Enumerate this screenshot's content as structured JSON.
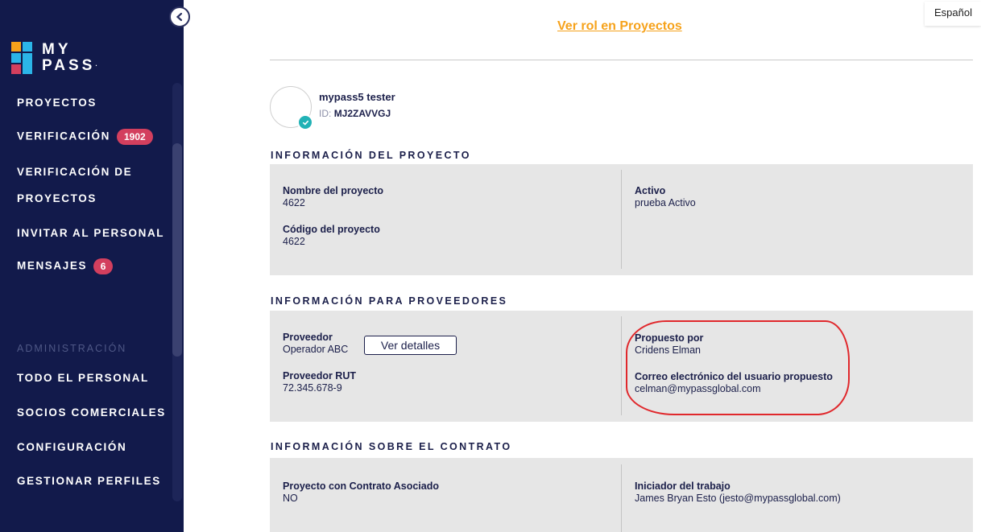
{
  "brand": {
    "line1": "MY",
    "line2": "PASS",
    "mark": "·"
  },
  "sidebar": {
    "items": [
      {
        "label": "PROYECTOS"
      },
      {
        "label": "VERIFICACIÓN",
        "badge": "1902"
      },
      {
        "label": "VERIFICACIÓN DE"
      },
      {
        "label": "PROYECTOS"
      },
      {
        "label": "INVITAR AL PERSONAL"
      },
      {
        "label": "MENSAJES",
        "badge": "6"
      }
    ],
    "admin_header": "ADMINISTRACIÓN",
    "admin_items": [
      {
        "label": "TODO EL PERSONAL"
      },
      {
        "label": "SOCIOS COMERCIALES"
      },
      {
        "label": "CONFIGURACIÓN"
      },
      {
        "label": "GESTIONAR PERFILES"
      }
    ]
  },
  "header": {
    "language": "Español",
    "link": "Ver rol en Proyectos"
  },
  "profile": {
    "name": "mypass5 tester",
    "id_label": "ID:",
    "id_value": "MJ2ZAVVGJ"
  },
  "project_info": {
    "title": "INFORMACIÓN DEL PROYECTO",
    "name_label": "Nombre del proyecto",
    "name_value": "4622",
    "code_label": "Código del proyecto",
    "code_value": "4622",
    "status_label": "Activo",
    "status_value": "prueba Activo"
  },
  "supplier_info": {
    "title": "INFORMACIÓN PARA PROVEEDORES",
    "supplier_label": "Proveedor",
    "supplier_value": "Operador ABC",
    "details_button": "Ver detalles",
    "rut_label": "Proveedor RUT",
    "rut_value": "72.345.678-9",
    "proposed_label": "Propuesto por",
    "proposed_value": "Cridens Elman",
    "email_label": "Correo electrónico del usuario propuesto",
    "email_value": "celman@mypassglobal.com"
  },
  "contract_info": {
    "title": "INFORMACIÓN SOBRE EL CONTRATO",
    "contract_label": "Proyecto con Contrato Asociado",
    "contract_value": "NO",
    "initiator_label": "Iniciador del trabajo",
    "initiator_value": "James Bryan Esto (jesto@mypassglobal.com)"
  },
  "colors": {
    "sidebar": "#121a4b",
    "badge": "#d33f5e",
    "link": "#f6a21b",
    "highlight": "#e0282c",
    "verified": "#22b2b6"
  }
}
